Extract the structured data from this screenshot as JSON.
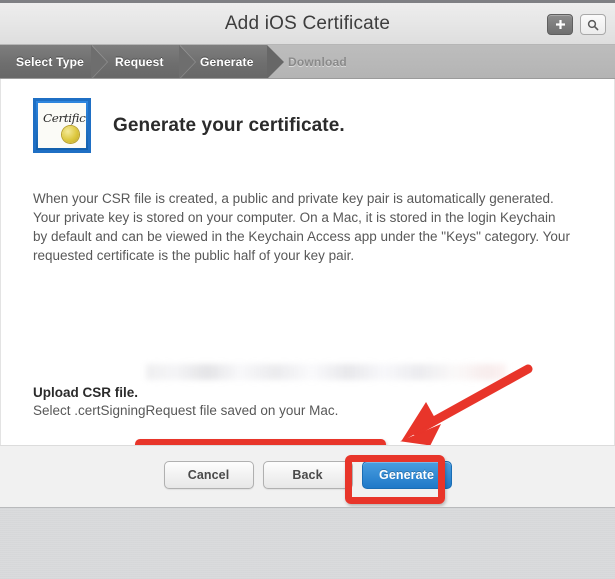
{
  "window": {
    "title": "Add iOS Certificate",
    "actions": [
      {
        "name": "add-button",
        "label": "+",
        "icon": "plus-icon"
      },
      {
        "name": "search-button",
        "label": "",
        "icon": "search-icon"
      }
    ]
  },
  "steps": [
    {
      "label": "Select Type",
      "state": "done"
    },
    {
      "label": "Request",
      "state": "done"
    },
    {
      "label": "Generate",
      "state": "current"
    },
    {
      "label": "Download",
      "state": "pending"
    }
  ],
  "content": {
    "icon_name": "certificate-icon",
    "icon_word": "Certificate",
    "heading": "Generate your certificate.",
    "paragraph": "When your CSR file is created, a public and private key pair is automatically generated. Your private key is stored on your computer. On a Mac, it is stored in the login Keychain by default and can be viewed in the Keychain Access app under the \"Keys\" category. Your requested certificate is the public half of your key pair.",
    "redacted_note": "",
    "upload_title": "Upload CSR file.",
    "upload_subtitle": "Select .certSigningRequest file saved on your Mac.",
    "choose_file_label": "Choose File…",
    "selected_file_name": "CertificateSigningRequest.certSigningRequest"
  },
  "footer": {
    "cancel_label": "Cancel",
    "back_label": "Back",
    "generate_label": "Generate"
  },
  "annotations": {
    "highlight_color": "#e8352a",
    "arrow_from": "upper-right",
    "arrow_to": "file-chip"
  },
  "colors": {
    "accent_blue": "#2f86d4",
    "annotation_red": "#e8352a",
    "title_bar": "#e6e6e6",
    "step_done": "#6e6e6e",
    "step_pending": "#b4b4b4"
  }
}
